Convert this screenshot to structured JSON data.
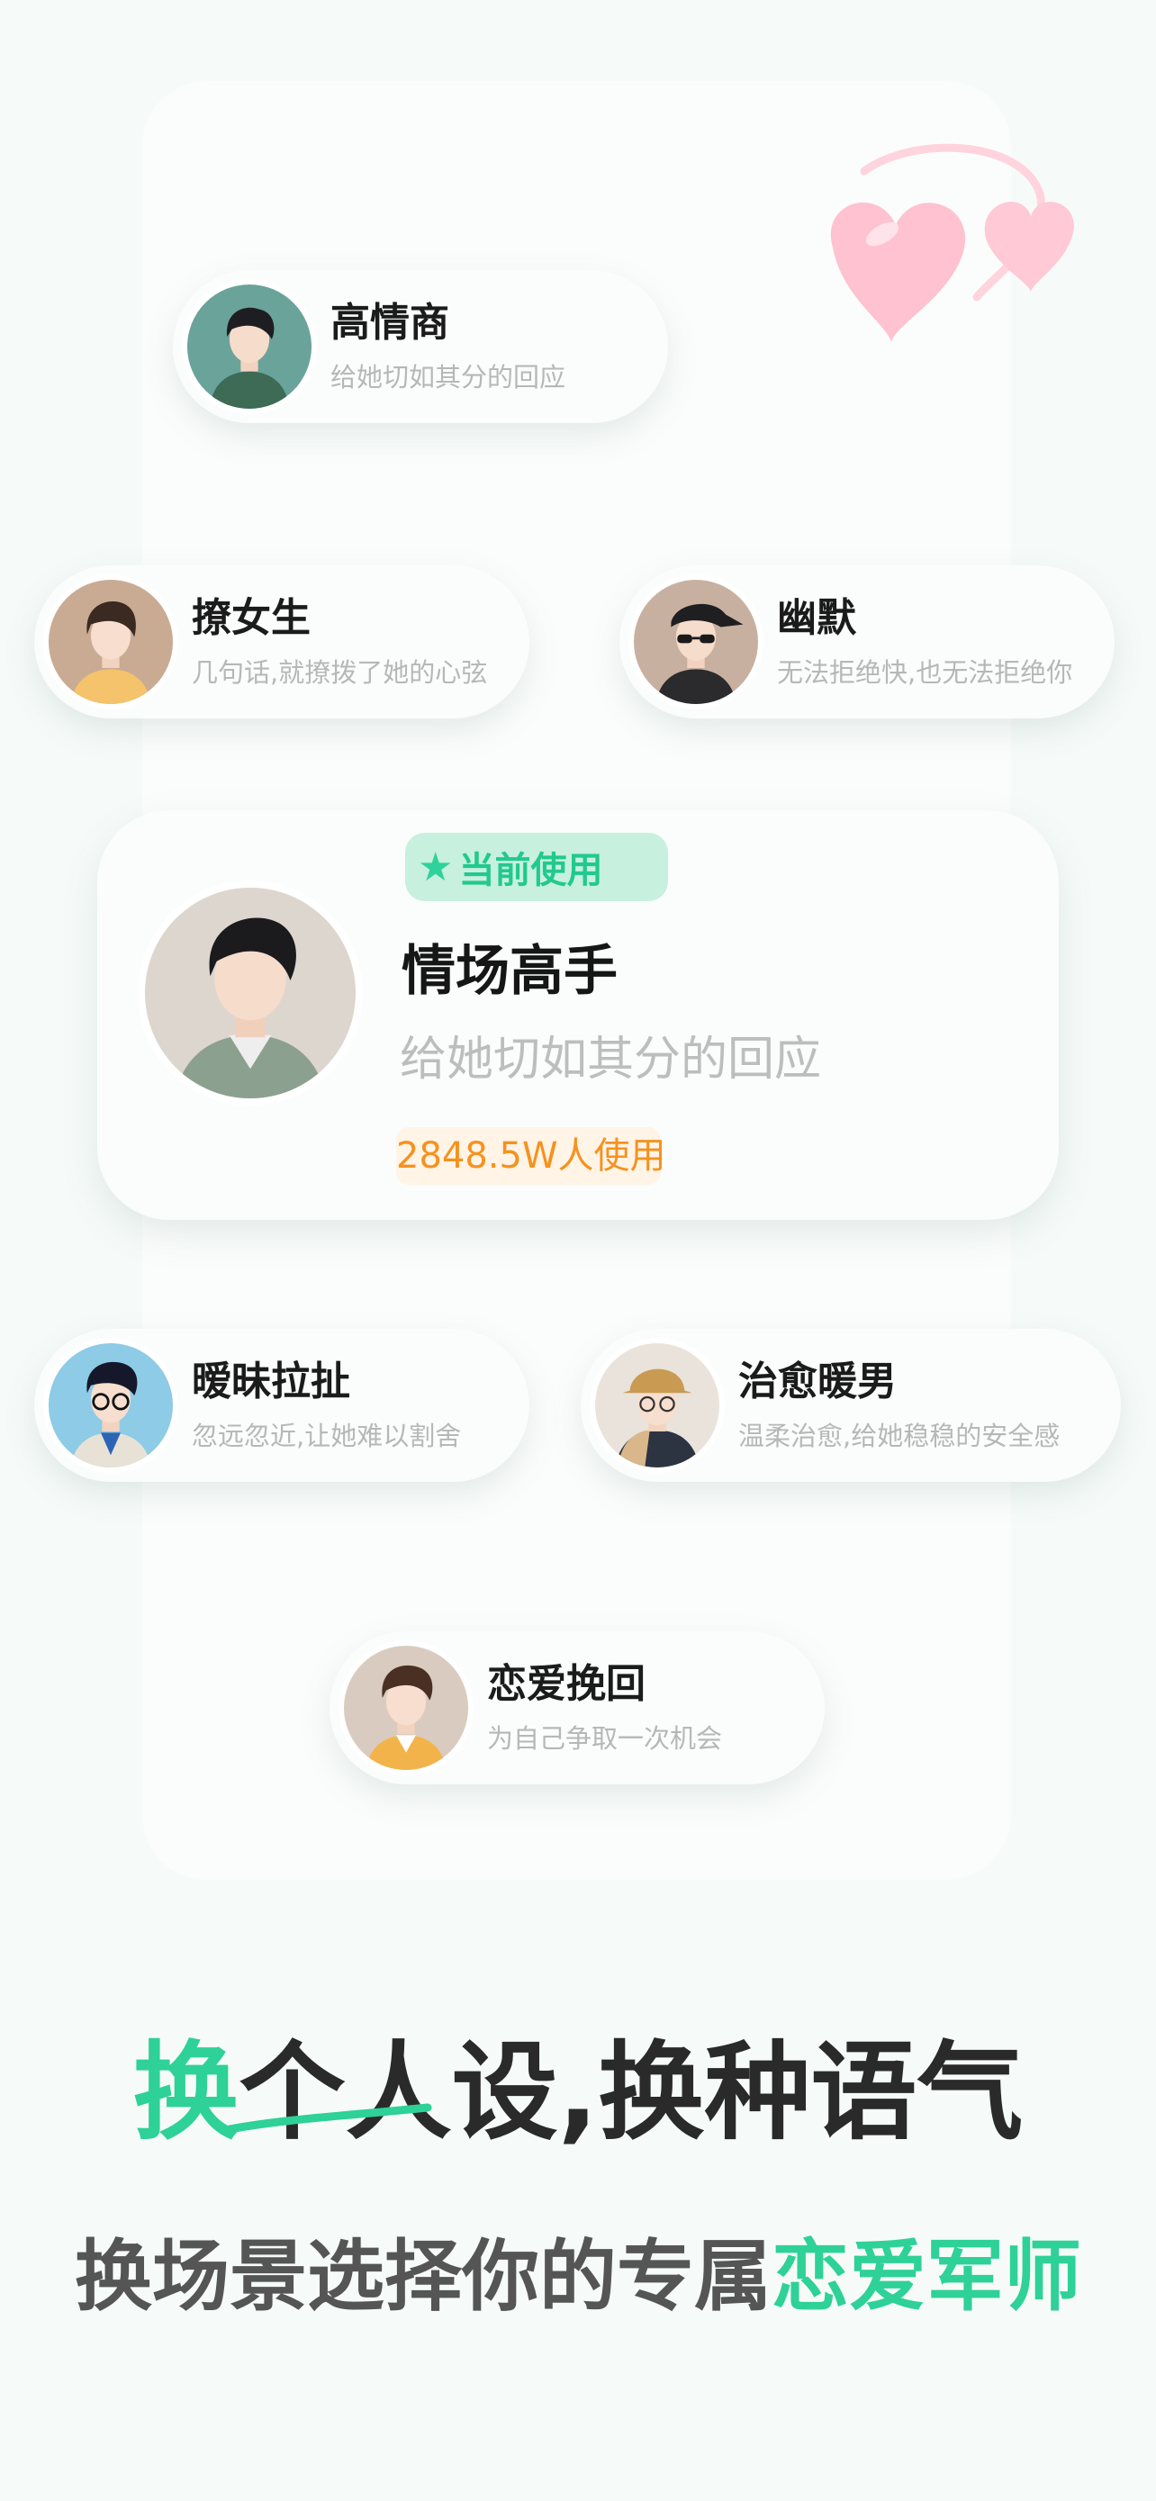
{
  "colors": {
    "accent_green": "#2ed197",
    "orange": "#f5921e",
    "page_bg": "#f6fbf9"
  },
  "decoration": "hearts-icon",
  "personas": [
    {
      "name": "高情商",
      "desc": "给她切如其分的回应"
    },
    {
      "name": "撩女生",
      "desc": "几句话,就撩拨了她的心弦"
    },
    {
      "name": "幽默",
      "desc": "无法拒绝快,也无法拒绝你"
    },
    {
      "name": "暧昧拉扯",
      "desc": "忽远忽近,让她难以割舍"
    },
    {
      "name": "治愈暖男",
      "desc": "温柔治愈,给她稳稳的安全感"
    },
    {
      "name": "恋爱挽回",
      "desc": "为自己争取一次机会"
    }
  ],
  "featured": {
    "badge": "当前使用",
    "name": "情场高手",
    "desc": "给她切如其分的回应",
    "usage": "2848.5W人使用"
  },
  "headline": {
    "accent": "换",
    "rest": "个人设,换种语气"
  },
  "subline": {
    "main": "换场景选择你的专属",
    "accent": "恋爱军师"
  }
}
